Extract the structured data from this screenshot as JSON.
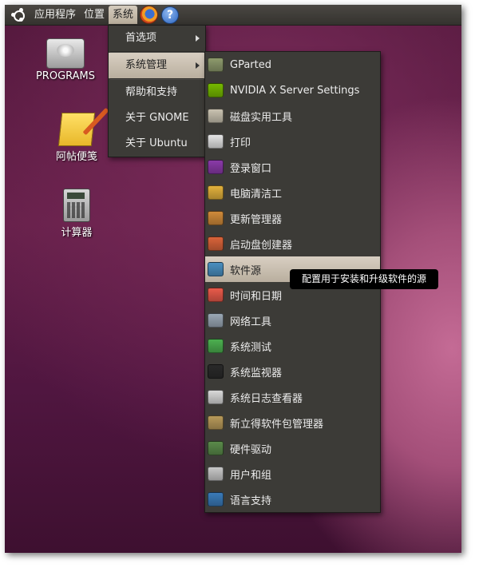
{
  "panel": {
    "menus": [
      "应用程序",
      "位置",
      "系统"
    ],
    "icons": [
      "ubuntu-logo-icon",
      "firefox-icon",
      "help-icon"
    ],
    "help_glyph": "?"
  },
  "desktop": {
    "icons": [
      {
        "label": "PROGRAMS",
        "icon": "hard-drive-icon"
      },
      {
        "label": "阿帖便笺",
        "icon": "notepad-icon"
      },
      {
        "label": "计算器",
        "icon": "calculator-icon"
      }
    ]
  },
  "system_menu": {
    "items": [
      {
        "label": "首选项",
        "submenu": true
      },
      {
        "label": "系统管理",
        "submenu": true,
        "active": true
      },
      {
        "label": "帮助和支持"
      },
      {
        "label": "关于 GNOME"
      },
      {
        "label": "关于 Ubuntu"
      }
    ]
  },
  "admin_menu": {
    "items": [
      {
        "label": "GParted",
        "icon": "gparted-icon",
        "color": "#8d9a6c"
      },
      {
        "label": "NVIDIA X Server Settings",
        "icon": "nvidia-icon",
        "color": "#76b900"
      },
      {
        "label": "磁盘实用工具",
        "icon": "disk-utility-icon",
        "color": "#c9c2b0"
      },
      {
        "label": "打印",
        "icon": "printer-icon",
        "color": "#e4e4e4"
      },
      {
        "label": "登录窗口",
        "icon": "login-window-icon",
        "color": "#8a3aa8"
      },
      {
        "label": "电脑清洁工",
        "icon": "broom-icon",
        "color": "#e2b13c"
      },
      {
        "label": "更新管理器",
        "icon": "update-manager-icon",
        "color": "#d08a3a"
      },
      {
        "label": "启动盘创建器",
        "icon": "startup-disk-icon",
        "color": "#d9643a"
      },
      {
        "label": "软件源",
        "icon": "software-sources-icon",
        "color": "#4a8fc0",
        "active": true
      },
      {
        "label": "时间和日期",
        "icon": "calendar-icon",
        "color": "#e85a4a"
      },
      {
        "label": "网络工具",
        "icon": "network-tools-icon",
        "color": "#9aa7b4"
      },
      {
        "label": "系统测试",
        "icon": "system-testing-icon",
        "color": "#4caf50"
      },
      {
        "label": "系统监视器",
        "icon": "system-monitor-icon",
        "color": "#2a2a2a"
      },
      {
        "label": "系统日志查看器",
        "icon": "log-viewer-icon",
        "color": "#d8d8d8"
      },
      {
        "label": "新立得软件包管理器",
        "icon": "synaptic-icon",
        "color": "#b89a5a"
      },
      {
        "label": "硬件驱动",
        "icon": "hardware-drivers-icon",
        "color": "#5a8a4a"
      },
      {
        "label": "用户和组",
        "icon": "users-groups-icon",
        "color": "#c8c8c8"
      },
      {
        "label": "语言支持",
        "icon": "language-support-icon",
        "color": "#3a7ab8"
      }
    ]
  },
  "tooltip": "配置用于安装和升级软件的源"
}
